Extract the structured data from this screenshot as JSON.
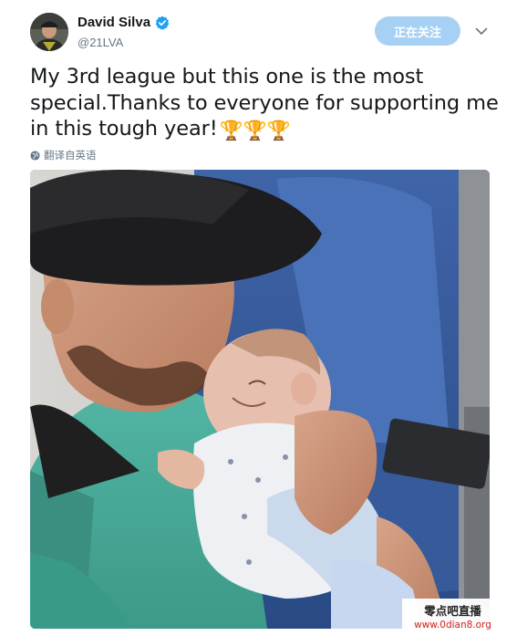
{
  "author": {
    "display_name": "David Silva",
    "handle": "@21LVA",
    "verified": true,
    "avatar_icon": "profile-photo"
  },
  "follow_button": {
    "label": "正在关注"
  },
  "menu_icon": "chevron-down-icon",
  "tweet": {
    "text": "My 3rd league but this one is the most special.Thanks to everyone for supporting me in this tough year!",
    "emoji": "🏆🏆🏆"
  },
  "translate_link": {
    "label": "翻译自英语",
    "icon": "globe-icon"
  },
  "media": {
    "description_icon": "photo"
  },
  "watermark": {
    "title": "零点吧直播",
    "url": "www.0dian8.org"
  },
  "colors": {
    "follow_button_bg": "#a7d1f4",
    "verified_blue": "#1da1f2",
    "handle_gray": "#657786",
    "watermark_red": "#d1231b"
  }
}
